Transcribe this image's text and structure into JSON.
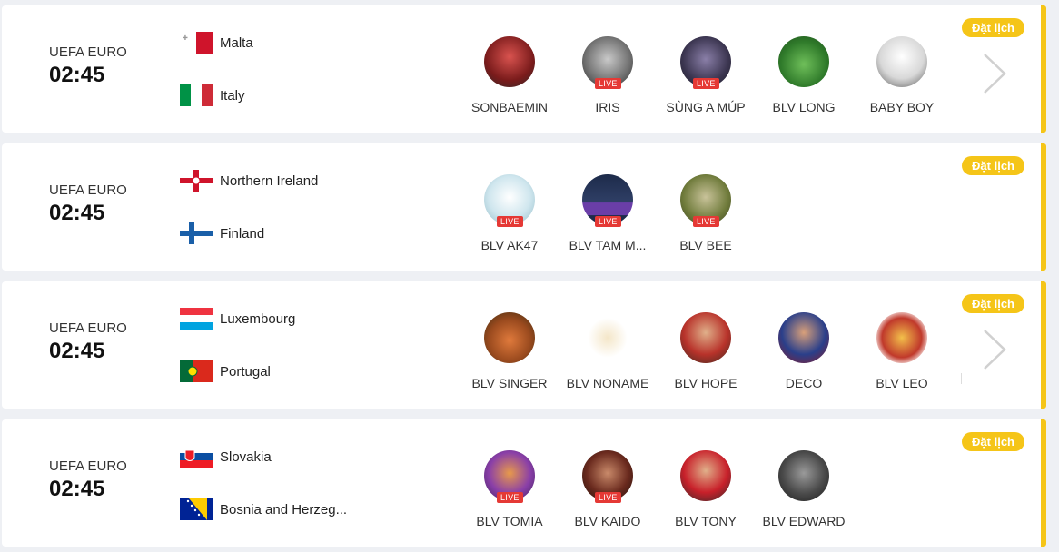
{
  "schedule_label": "Đặt lịch",
  "live_label": "LIVE",
  "matches": [
    {
      "league": "UEFA EURO",
      "time": "02:45",
      "home": "Malta",
      "away": "Italy",
      "commentators": [
        {
          "name": "SONBAEMIN",
          "live": false
        },
        {
          "name": "IRIS",
          "live": true
        },
        {
          "name": "SÙNG A MÚP",
          "live": true
        },
        {
          "name": "BLV LONG",
          "live": false
        },
        {
          "name": "BABY BOY",
          "live": false
        }
      ]
    },
    {
      "league": "UEFA EURO",
      "time": "02:45",
      "home": "Northern Ireland",
      "away": "Finland",
      "commentators": [
        {
          "name": "BLV AK47",
          "live": true
        },
        {
          "name": "BLV TAM M...",
          "live": true
        },
        {
          "name": "BLV BEE",
          "live": true
        }
      ]
    },
    {
      "league": "UEFA EURO",
      "time": "02:45",
      "home": "Luxembourg",
      "away": "Portugal",
      "commentators": [
        {
          "name": "BLV SINGER",
          "live": false
        },
        {
          "name": "BLV NONAME",
          "live": false
        },
        {
          "name": "BLV HOPE",
          "live": false
        },
        {
          "name": "DECO",
          "live": false
        },
        {
          "name": "BLV LEO",
          "live": false
        }
      ]
    },
    {
      "league": "UEFA EURO",
      "time": "02:45",
      "home": "Slovakia",
      "away": "Bosnia and Herzeg...",
      "commentators": [
        {
          "name": "BLV TOMIA",
          "live": true
        },
        {
          "name": "BLV KAIDO",
          "live": true
        },
        {
          "name": "BLV TONY",
          "live": false
        },
        {
          "name": "BLV EDWARD",
          "live": false
        }
      ]
    }
  ],
  "colors": {
    "accent": "#f5c518",
    "live": "#e53935"
  }
}
